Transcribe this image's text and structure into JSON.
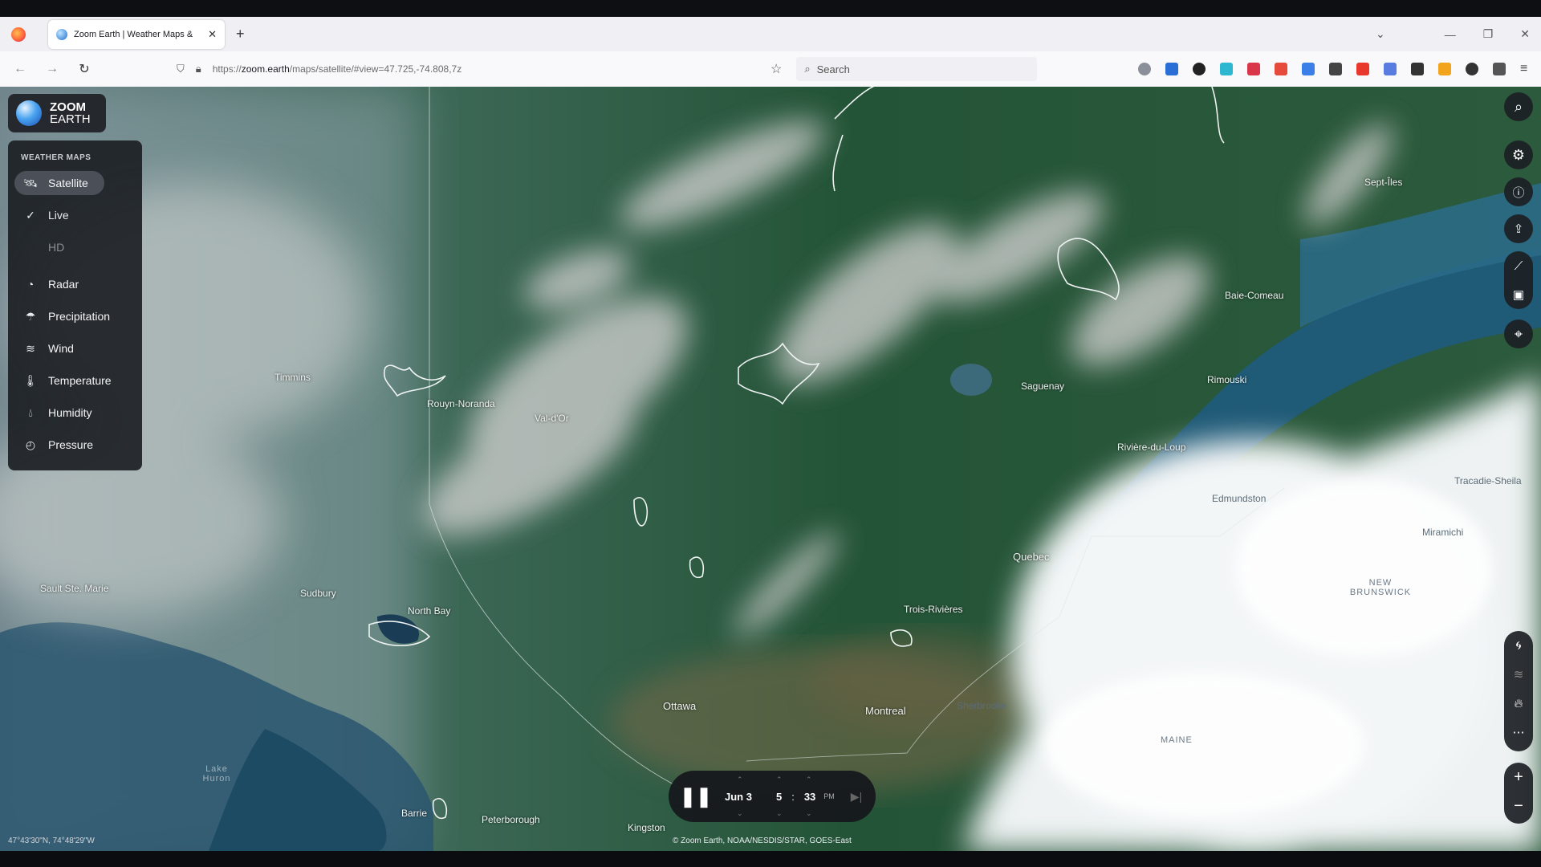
{
  "browser": {
    "tab_title": "Zoom Earth | Weather Maps &",
    "tab_close": "✕",
    "new_tab": "+",
    "url_prefix": "https://",
    "url_domain": "zoom.earth",
    "url_path": "/maps/satellite/#view=47.725,-74.808,7z",
    "search_placeholder": "Search"
  },
  "app": {
    "logo_line1": "ZOOM",
    "logo_line2": "EARTH"
  },
  "menu": {
    "heading": "WEATHER MAPS",
    "items": [
      {
        "label": "Satellite",
        "icon": "satellite-icon"
      },
      {
        "label": "Live",
        "icon": "check-icon"
      },
      {
        "label": "HD",
        "icon": ""
      },
      {
        "label": "Radar",
        "icon": "radar-icon"
      },
      {
        "label": "Precipitation",
        "icon": "precipitation-icon"
      },
      {
        "label": "Wind",
        "icon": "wind-icon"
      },
      {
        "label": "Temperature",
        "icon": "thermometer-icon"
      },
      {
        "label": "Humidity",
        "icon": "humidity-icon"
      },
      {
        "label": "Pressure",
        "icon": "pressure-icon"
      }
    ]
  },
  "map_labels": {
    "timmins": "Timmins",
    "rouyn": "Rouyn-Noranda",
    "valdor": "Val-d'Or",
    "saguenay": "Saguenay",
    "septiles": "Sept-Îles",
    "baiecomeau": "Baie-Comeau",
    "rimouski": "Rimouski",
    "riviere": "Rivière-du-Loup",
    "edmundston": "Edmundston",
    "tracadie": "Tracadie-Sheila",
    "miramichi": "Miramichi",
    "newbrunswick": "NEW BRUNSWICK",
    "quebec": "Quebec",
    "troisrivieres": "Trois-Rivières",
    "saultste": "Sault Ste. Marie",
    "sudbury": "Sudbury",
    "northbay": "North Bay",
    "ottawa": "Ottawa",
    "montreal": "Montreal",
    "sherbrooke": "Sherbrooke",
    "maine": "MAINE",
    "lakehuron": "Lake Huron",
    "barrie": "Barrie",
    "peterborough": "Peterborough",
    "kingston": "Kingston"
  },
  "timeline": {
    "date": "Jun 3",
    "hour": "5",
    "separator": ":",
    "minute": "33",
    "ampm": "PM"
  },
  "status": {
    "coordinates": "47°43'30\"N, 74°48'29\"W",
    "attribution": "© Zoom Earth, NOAA/NESDIS/STAR, GOES-East"
  },
  "colors": {
    "panel_bg": "#1c1f24",
    "active_item": "#4b5058",
    "land": "#2f5a3f",
    "water": "#1f4d63",
    "cloud": "#e9eef0"
  }
}
